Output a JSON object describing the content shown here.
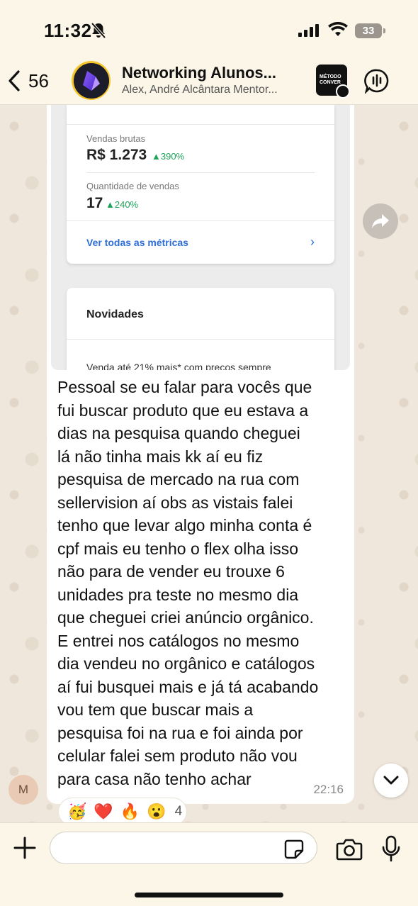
{
  "status_bar": {
    "time": "11:32",
    "battery": "33"
  },
  "header": {
    "back_count": "56",
    "title": "Networking Alunos...",
    "subtitle": "Alex, André Alcântara Mentor...",
    "community_badge": "MÉTODO CONVER"
  },
  "message": {
    "screenshot": {
      "gross_sales_label": "Vendas brutas",
      "gross_sales_value": "R$ 1.273",
      "gross_sales_change": "▲390%",
      "qty_label": "Quantidade de vendas",
      "qty_value": "17",
      "qty_change": "▲240%",
      "metrics_link": "Ver todas as métricas",
      "news_title": "Novidades",
      "news_text": "Venda até 21% mais* com preços sempre"
    },
    "text": "Pessoal se eu falar para vocês que\nfui buscar produto que eu estava a\ndias na pesquisa quando cheguei\nlá não tinha mais kk  aí eu fiz\npesquisa de mercado na rua com\nsellervision aí obs as vistais  falei\ntenho que levar algo minha conta é\ncpf mais eu tenho o flex olha isso\nnão para de vender eu trouxe 6\nunidades pra teste no mesmo dia\nque cheguei criei anúncio orgânico.\nE entrei nos catálogos  no mesmo\ndia vendeu no orgânico e catálogos\naí fui busquei mais e já tá acabando\nvou tem que buscar mais a\npesquisa foi na rua e foi ainda por\ncelular falei sem produto não vou\npara casa não tenho achar",
    "time": "22:16",
    "sender_initial": "M"
  },
  "reactions": {
    "emojis": [
      "🥳",
      "❤️",
      "🔥",
      "😮"
    ],
    "count": "4"
  },
  "input": {
    "value": "",
    "placeholder": ""
  },
  "colors": {
    "header_bg": "#fbf6e7",
    "wallpaper": "#efe7dc",
    "positive": "#1fa35a",
    "link": "#2d6fd6"
  }
}
